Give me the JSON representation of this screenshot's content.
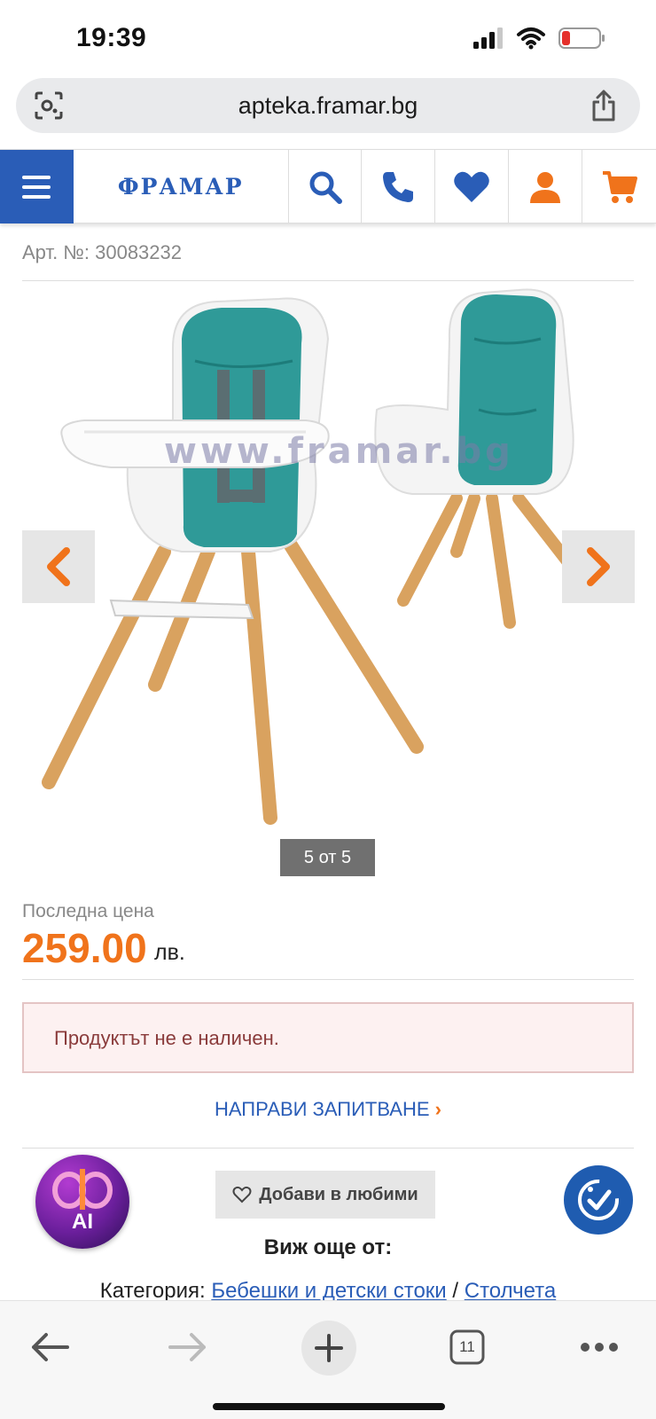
{
  "status_bar": {
    "time": "19:39"
  },
  "browser": {
    "url": "apteka.framar.bg",
    "tab_count": "11"
  },
  "site": {
    "logo_text": "ФРАМАР",
    "brand_color": "#2a5db7",
    "accent_color": "#f0731b"
  },
  "product": {
    "article_no": "Арт. №: 30083232",
    "image_counter": "5 от 5",
    "watermark": "www.framar.bg",
    "price_label": "Последна цена",
    "price": "259.00",
    "currency": "лв.",
    "availability": "Продуктът не е наличен.",
    "inquiry_label": "НАПРАВИ ЗАПИТВАНЕ",
    "favorite_label": "Добави в любими",
    "see_more": "Виж още от:",
    "category_prefix": "Категория:",
    "category_link_1": "Бебешки и детски стоки",
    "category_sep": "/",
    "category_link_2": "Столчета"
  },
  "ai_badge": {
    "label": "AI"
  }
}
